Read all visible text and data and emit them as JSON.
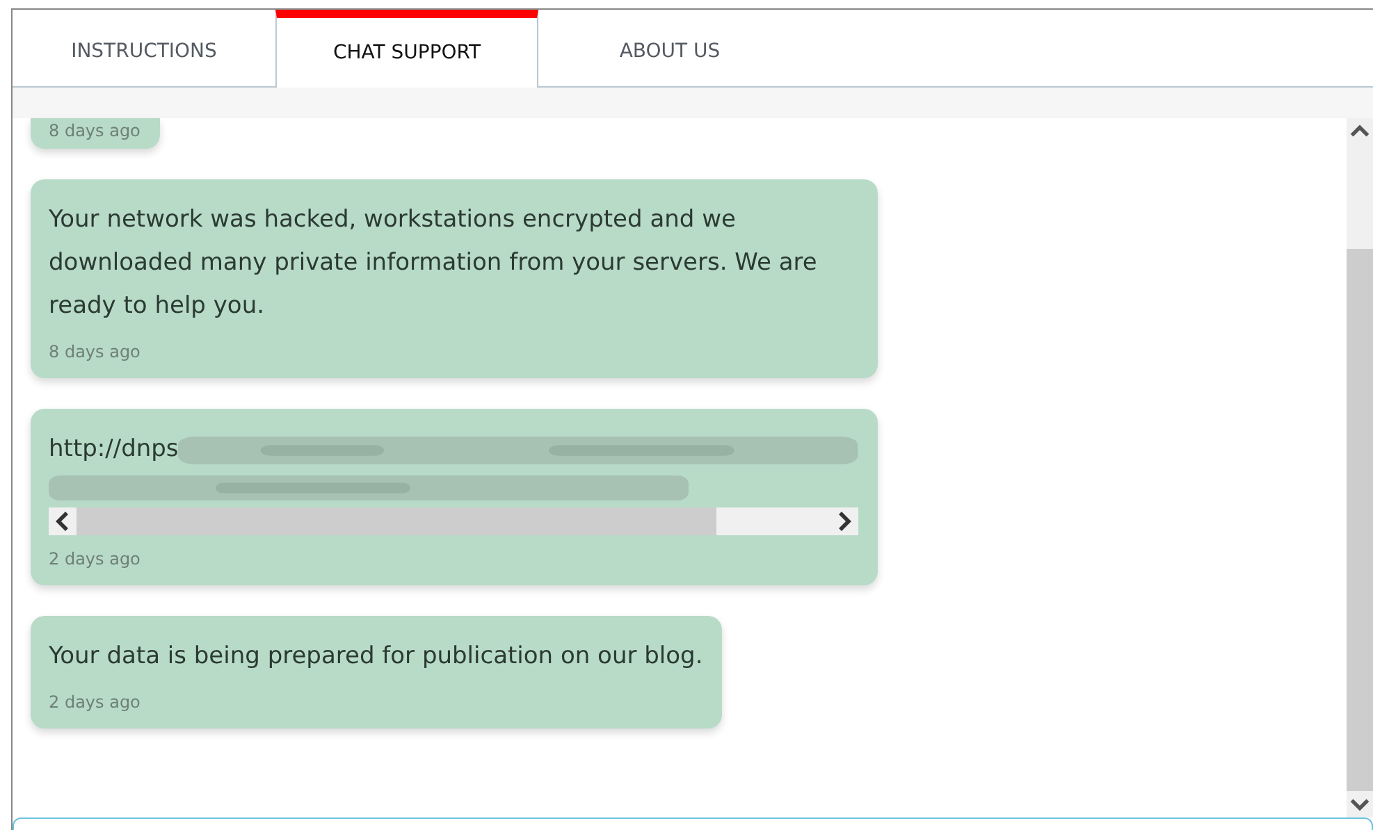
{
  "tabs": [
    {
      "label": "INSTRUCTIONS",
      "selected": false
    },
    {
      "label": "CHAT SUPPORT",
      "selected": true
    },
    {
      "label": "ABOUT US",
      "selected": false
    }
  ],
  "messages": [
    {
      "kind": "stub",
      "time": "8 days ago"
    },
    {
      "kind": "text",
      "text": "Your network was hacked, workstations encrypted and we downloaded many private information from your servers. We are ready to help you.",
      "time": "8 days ago"
    },
    {
      "kind": "link",
      "text": "http://dnps",
      "time": "2 days ago"
    },
    {
      "kind": "text",
      "text": "Your data is being prepared for publication on our blog.",
      "time": "2 days ago"
    }
  ]
}
